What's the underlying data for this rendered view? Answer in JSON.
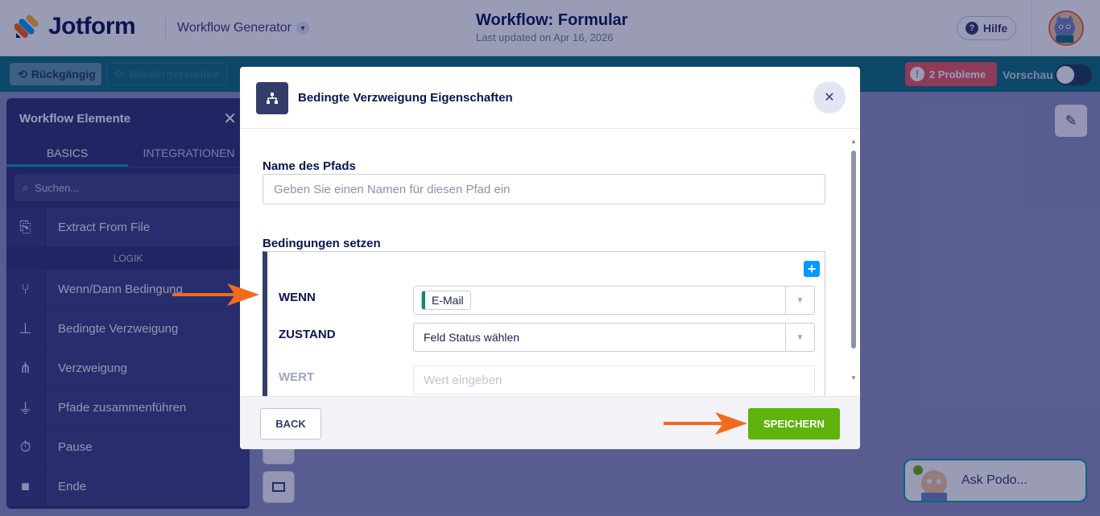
{
  "app": {
    "brand": "Jotform",
    "product_switcher": "Workflow Generator",
    "workflow_title": "Workflow: Formular",
    "last_updated": "Last updated on Apr 16, 2026",
    "help_label": "Hilfe"
  },
  "toolbar": {
    "undo_label": "Rückgängig",
    "redo_label": "Wiederherstellen",
    "problems_label": "2 Probleme",
    "preview_label": "Vorschau"
  },
  "panel": {
    "title": "Workflow Elemente",
    "tabs": [
      "BASICS",
      "INTEGRATIONEN"
    ],
    "search_placeholder": "Suchen...",
    "items": [
      {
        "icon": "extract-file-icon",
        "label": "Extract From File"
      },
      {
        "icon": "if-then-icon",
        "label": "Wenn/Dann Bedingung"
      },
      {
        "icon": "conditional-branch-icon",
        "label": "Bedingte Verzweigung"
      },
      {
        "icon": "branch-icon",
        "label": "Verzweigung"
      },
      {
        "icon": "merge-paths-icon",
        "label": "Pfade zusammenführen"
      },
      {
        "icon": "stopwatch-icon",
        "label": "Pause"
      },
      {
        "icon": "end-square-icon",
        "label": "Ende"
      }
    ],
    "category_logic": "LOGIK"
  },
  "assistant": {
    "label": "Ask Podo..."
  },
  "modal": {
    "title": "Bedingte Verzweigung Eigenschaften",
    "path_name_label": "Name des Pfads",
    "path_name_placeholder": "Geben Sie einen Namen für diesen Pfad ein",
    "conditions_label": "Bedingungen setzen",
    "wenn_label": "WENN",
    "wenn_value": "E-Mail",
    "zustand_label": "ZUSTAND",
    "zustand_value": "Feld Status wählen",
    "wert_label": "WERT",
    "wert_placeholder": "Wert eingeben",
    "back_label": "BACK",
    "save_label": "SPEICHERN"
  },
  "colors": {
    "accent_teal": "#0d6d7a",
    "save_green": "#5fb30d",
    "problem_red": "#e7585f",
    "arrow_orange": "#f26a1b",
    "add_blue": "#0099ff"
  }
}
